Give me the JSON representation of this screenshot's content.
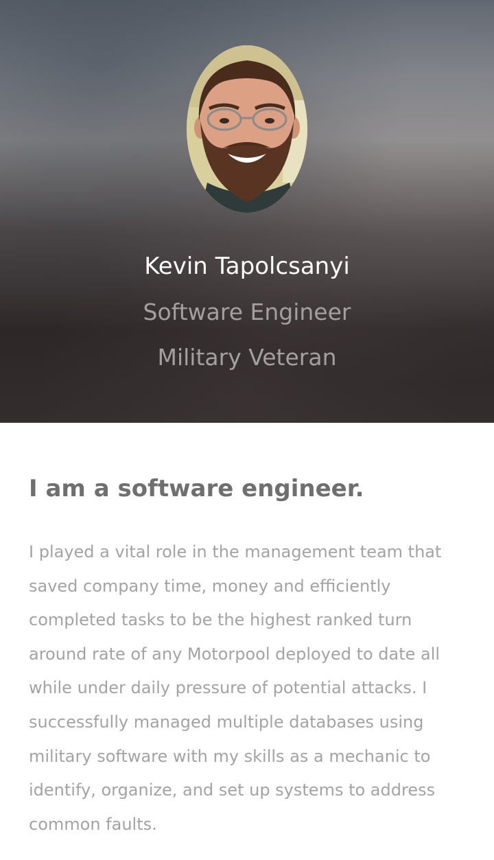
{
  "header": {
    "name": "Kevin Tapolcsanyi",
    "titles": [
      "Software Engineer",
      "Military Veteran"
    ],
    "avatar": "profile-photo"
  },
  "about": {
    "heading": "I am a software engineer.",
    "body": "I played a vital role in the management team that saved company time, money and efficiently completed tasks to be the highest ranked turn around rate of any Motorpool deployed to date all while under daily pressure of potential attacks. I successfully managed multiple databases using military software with my skills as a mechanic to identify, organize, and set up systems to address common faults."
  },
  "colors": {
    "name_text": "#ffffff",
    "tagline_text": "#a4a09f",
    "heading_text": "#6f6f6f",
    "body_text": "#a3a3a3"
  }
}
